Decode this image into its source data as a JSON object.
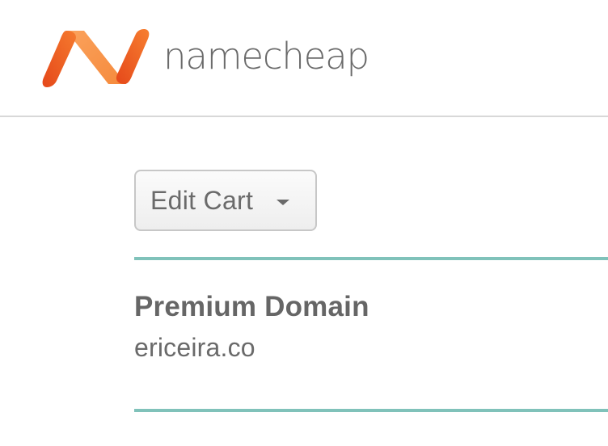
{
  "header": {
    "logo_text": "namecheap",
    "logo_icon": "namecheap-logo-icon",
    "brand_colors": {
      "orange_dark": "#e8501e",
      "orange_light": "#f58a3c"
    }
  },
  "cart": {
    "edit_label": "Edit Cart",
    "dropdown_icon": "caret-down-icon",
    "accent_color": "#80c2ba"
  },
  "item": {
    "type": "Premium Domain",
    "domain": "ericeira.co"
  }
}
